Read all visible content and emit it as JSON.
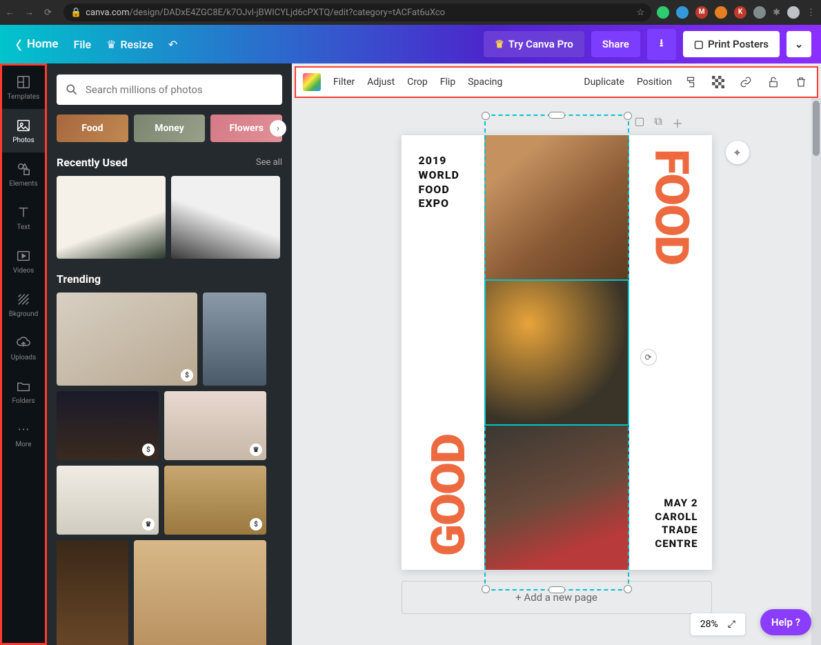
{
  "browser": {
    "url_host": "canva.com",
    "url_path": "/design/DADxE4ZGC8E/k7OJvl-jBWICYLjd6cPXTQ/edit?category=tACFat6uXco"
  },
  "topbar": {
    "home": "Home",
    "file": "File",
    "resize": "Resize",
    "try_pro": "Try Canva Pro",
    "share": "Share",
    "print": "Print Posters"
  },
  "sidebar": {
    "items": [
      {
        "label": "Templates",
        "icon": "templates"
      },
      {
        "label": "Photos",
        "icon": "photos"
      },
      {
        "label": "Elements",
        "icon": "elements"
      },
      {
        "label": "Text",
        "icon": "text"
      },
      {
        "label": "Videos",
        "icon": "videos"
      },
      {
        "label": "Bkground",
        "icon": "bkground"
      },
      {
        "label": "Uploads",
        "icon": "uploads"
      },
      {
        "label": "Folders",
        "icon": "folders"
      },
      {
        "label": "More",
        "icon": "more"
      }
    ],
    "active_index": 1
  },
  "panel": {
    "search_placeholder": "Search millions of photos",
    "chips": [
      "Food",
      "Money",
      "Flowers"
    ],
    "recently_used": {
      "title": "Recently Used",
      "see_all": "See all"
    },
    "trending": {
      "title": "Trending"
    }
  },
  "context_bar": {
    "items": [
      "Filter",
      "Adjust",
      "Crop",
      "Flip",
      "Spacing"
    ],
    "right_items": [
      "Duplicate",
      "Position"
    ]
  },
  "canvas": {
    "add_page": "+ Add a new page",
    "zoom": "28%",
    "help": "Help ?"
  },
  "poster": {
    "title_lines": "2019\nWORLD\nFOOD\nEXPO",
    "foot_lines": "MAY 2\nCAROLL\nTRADE\nCENTRE",
    "word_top": "FOOD",
    "word_bottom": "GOOD"
  }
}
